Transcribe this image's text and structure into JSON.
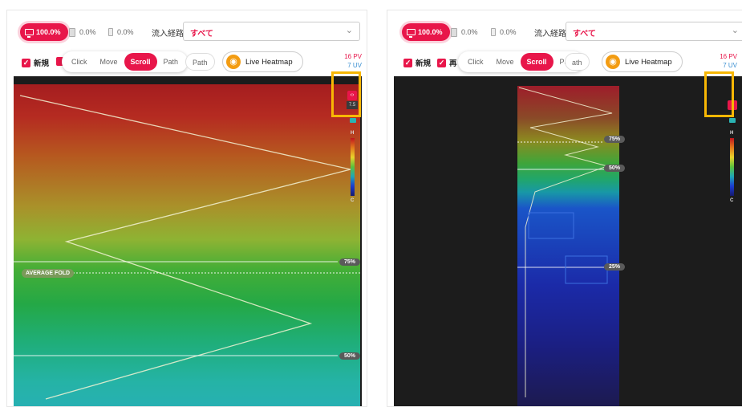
{
  "left": {
    "device": {
      "desktop": "100.0%",
      "tablet": "0.0%",
      "mobile": "0.0%"
    },
    "source_label": "流入経路",
    "source_value": "すべて",
    "filters": [
      {
        "label": "新規"
      }
    ],
    "modes": [
      "Click",
      "Move",
      "Scroll",
      "Path"
    ],
    "active_mode": "Scroll",
    "path_extra": "Path",
    "live_heatmap": "Live Heatmap",
    "stats": {
      "pv": "16 PV",
      "uv": "7 UV"
    },
    "fold_markers": [
      "75%",
      "50%"
    ],
    "average_fold": "AVERAGE FOLD",
    "legend": {
      "high": "H",
      "low": "C"
    }
  },
  "right": {
    "device": {
      "desktop": "100.0%",
      "tablet": "0.0%",
      "mobile": "0.0%"
    },
    "source_label": "流入経路",
    "source_value": "すべて",
    "filters": [
      {
        "label": "新規"
      },
      {
        "label": "再"
      }
    ],
    "modes": [
      "Click",
      "Move",
      "Scroll",
      "Path"
    ],
    "active_mode": "Scroll",
    "path_extra": "ath",
    "live_heatmap": "Live Heatmap",
    "stats": {
      "pv": "16 PV",
      "uv": "7 UV"
    },
    "fold_markers": [
      "75%",
      "50%",
      "25%"
    ],
    "legend": {
      "high": "H",
      "low": "C"
    }
  },
  "colors": {
    "accent": "#e8164a",
    "highlight": "#f8b704",
    "uv": "#3a8fd1"
  }
}
